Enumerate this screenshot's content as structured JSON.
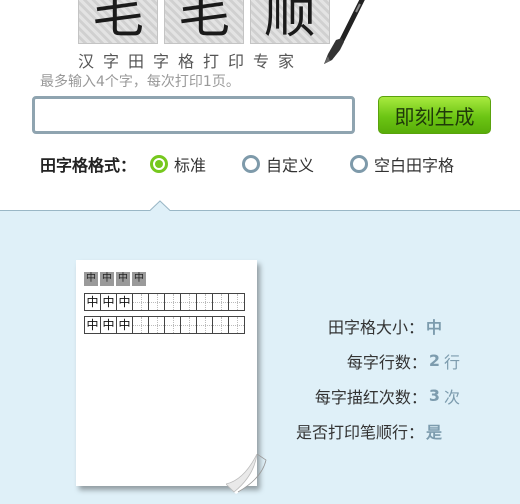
{
  "logo": {
    "chars": [
      "毛",
      "毛",
      "顺"
    ],
    "subtitle": "汉字田字格打印专家"
  },
  "hint": "最多输入4个字，每次打印1页。",
  "input": {
    "value": "",
    "placeholder": ""
  },
  "generate_button": "即刻生成",
  "format": {
    "label": "田字格格式：",
    "options": [
      {
        "label": "标准",
        "checked": true
      },
      {
        "label": "自定义",
        "checked": false
      },
      {
        "label": "空白田字格",
        "checked": false
      }
    ]
  },
  "preview": {
    "order_chars": [
      "中",
      "中",
      "中",
      "中"
    ],
    "row1_chars": [
      "中",
      "中",
      "中"
    ],
    "row2_chars": [
      "中",
      "中",
      "中"
    ]
  },
  "settings": {
    "size": {
      "label": "田字格大小：",
      "value": "中"
    },
    "rows": {
      "label": "每字行数：",
      "value": "2",
      "unit": "行"
    },
    "trace": {
      "label": "每字描红次数：",
      "value": "3",
      "unit": "次"
    },
    "stroke_order": {
      "label": "是否打印笔顺行：",
      "value": "是"
    }
  },
  "colors": {
    "accent_green": "#76c81e",
    "panel_bg": "#dff0f8",
    "value_blue": "#7d9cae"
  }
}
